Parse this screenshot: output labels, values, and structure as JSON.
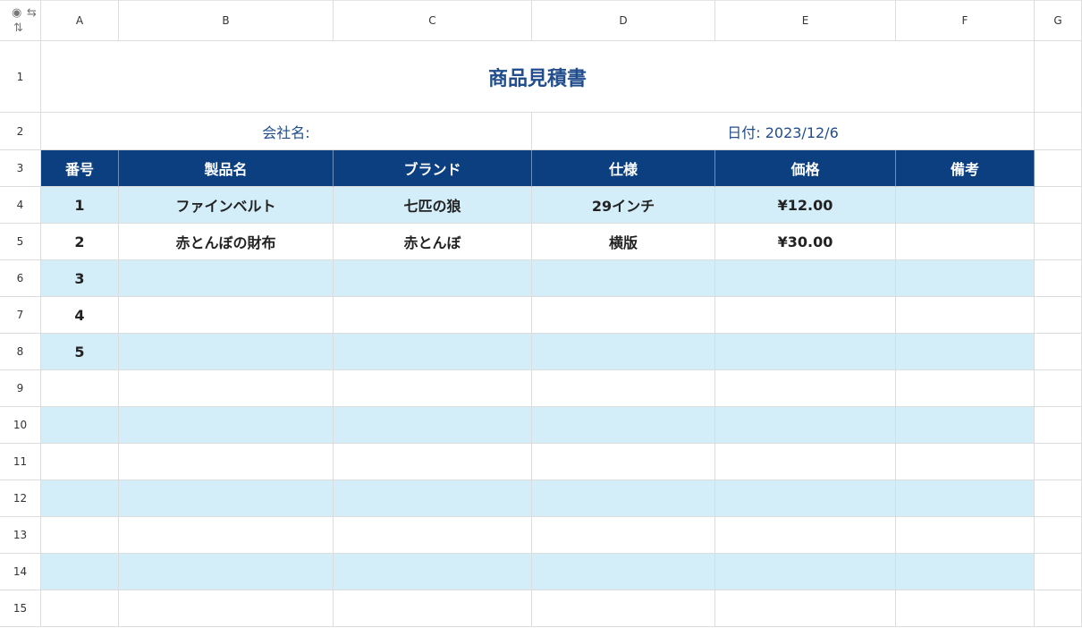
{
  "spreadsheet": {
    "corner_icons": [
      "eye-icon",
      "freeze-columns-icon",
      "freeze-rows-icon"
    ],
    "column_headers": [
      "A",
      "B",
      "C",
      "D",
      "E",
      "F",
      "G"
    ],
    "row_headers": [
      "1",
      "2",
      "3",
      "4",
      "5",
      "6",
      "7",
      "8",
      "9",
      "10",
      "11",
      "12",
      "13",
      "14",
      "15"
    ],
    "title": "商品見積書",
    "company_label": "会社名:",
    "date_label": "日付: 2023/12/6",
    "table_headers": [
      "番号",
      "製品名",
      "ブランド",
      "仕様",
      "価格",
      "備考"
    ],
    "rows": [
      [
        "1",
        "ファインベルト",
        "七匹の狼",
        "29インチ",
        "¥12.00",
        ""
      ],
      [
        "2",
        "赤とんぼの財布",
        "赤とんぼ",
        "横版",
        "¥30.00",
        ""
      ],
      [
        "3",
        "",
        "",
        "",
        "",
        ""
      ],
      [
        "4",
        "",
        "",
        "",
        "",
        ""
      ],
      [
        "5",
        "",
        "",
        "",
        "",
        ""
      ],
      [
        "",
        "",
        "",
        "",
        "",
        ""
      ],
      [
        "",
        "",
        "",
        "",
        "",
        ""
      ],
      [
        "",
        "",
        "",
        "",
        "",
        ""
      ],
      [
        "",
        "",
        "",
        "",
        "",
        ""
      ],
      [
        "",
        "",
        "",
        "",
        "",
        ""
      ],
      [
        "",
        "",
        "",
        "",
        "",
        ""
      ],
      [
        "",
        "",
        "",
        "",
        "",
        ""
      ]
    ],
    "colors": {
      "header_fill": "#0b3f7f",
      "alt_row_fill": "#d3edf9",
      "title_text": "#214d8c",
      "grid_line": "#dcdcdc"
    }
  }
}
